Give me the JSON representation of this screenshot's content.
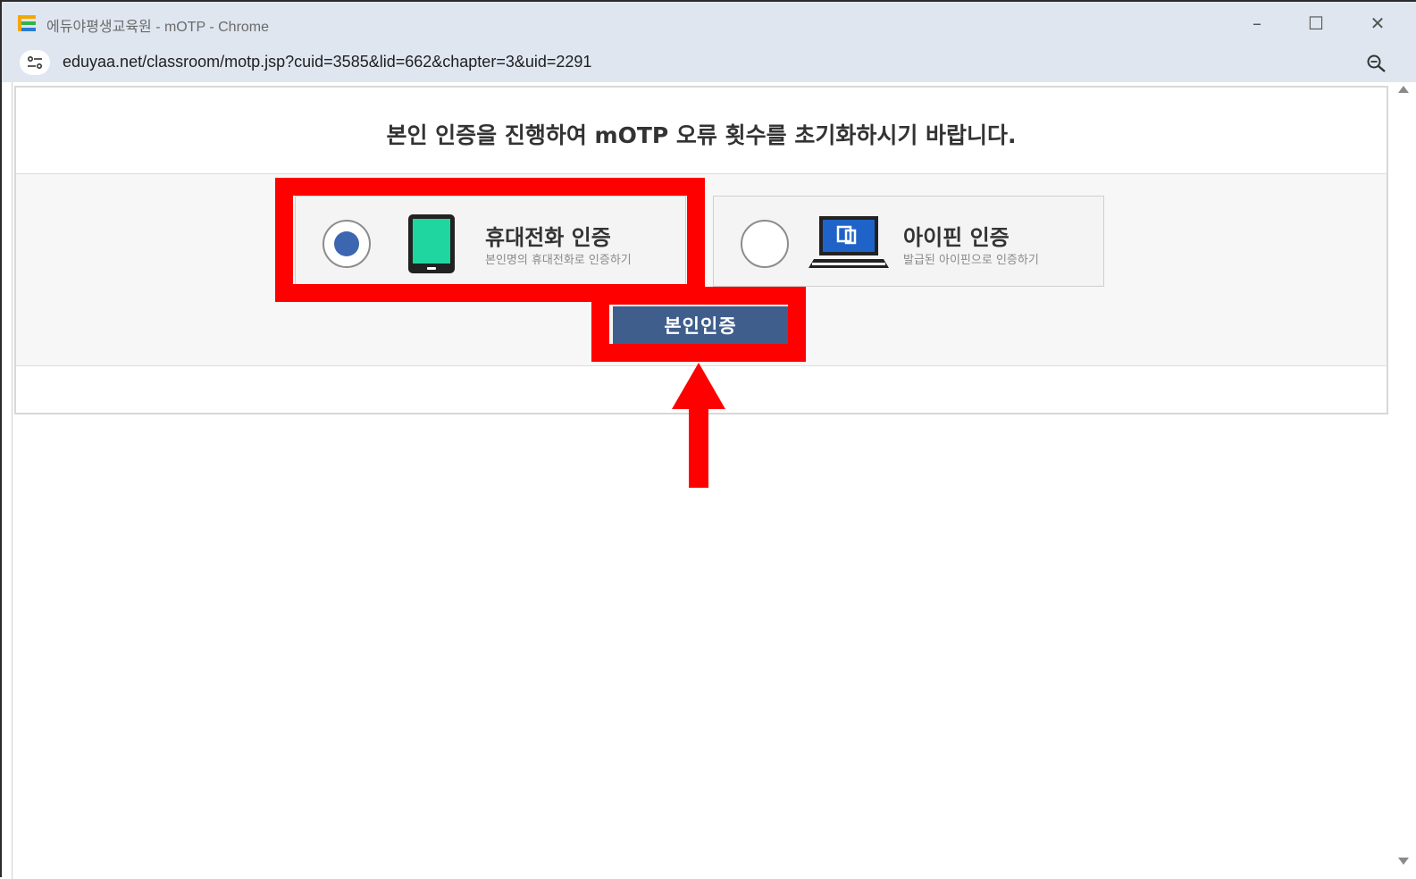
{
  "window": {
    "title": "에듀야평생교육원 - mOTP - Chrome",
    "controls": {
      "minimize": "–",
      "maximize": "☐",
      "close": "✕"
    }
  },
  "address_bar": {
    "url": "eduyaa.net/classroom/motp.jsp?cuid=3585&lid=662&chapter=3&uid=2291",
    "icons": [
      "site-info-icon",
      "zoom-icon"
    ]
  },
  "page": {
    "heading": "본인 인증을 진행하여 mOTP 오류 횟수를 초기화하시기 바랍니다.",
    "options": [
      {
        "title": "휴대전화 인증",
        "subtitle": "본인명의 휴대전화로 인증하기",
        "selected": true,
        "icon": "smartphone-icon"
      },
      {
        "title": "아이핀 인증",
        "subtitle": "발급된 아이핀으로 인증하기",
        "selected": false,
        "icon": "laptop-icon"
      }
    ],
    "submit_label": "본인인증"
  },
  "colors": {
    "highlight": "#ff0000",
    "button": "#3f5e8c",
    "radio_selected": "#3d66b0",
    "phone_screen": "#1fd6a0",
    "laptop_screen": "#1f63c9"
  }
}
